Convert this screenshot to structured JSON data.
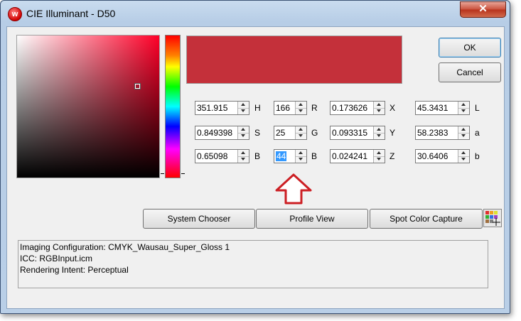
{
  "window": {
    "title": "CIE Illuminant - D50",
    "close_glyph": "✕",
    "app_icon_letter": "w"
  },
  "buttons": {
    "ok": "OK",
    "cancel": "Cancel",
    "system_chooser": "System Chooser",
    "profile_view": "Profile View",
    "spot_color_capture": "Spot Color Capture"
  },
  "preview_color": "#c4303a",
  "fields": {
    "hsb": [
      {
        "value": "351.915",
        "label": "H"
      },
      {
        "value": "0.849398",
        "label": "S"
      },
      {
        "value": "0.65098",
        "label": "B"
      }
    ],
    "rgb": [
      {
        "value": "166",
        "label": "R"
      },
      {
        "value": "25",
        "label": "G"
      },
      {
        "value": "44",
        "label": "B"
      }
    ],
    "xyz": [
      {
        "value": "0.173626",
        "label": "X"
      },
      {
        "value": "0.093315",
        "label": "Y"
      },
      {
        "value": "0.024241",
        "label": "Z"
      }
    ],
    "lab": [
      {
        "value": "45.3431",
        "label": "L"
      },
      {
        "value": "58.2383",
        "label": "a"
      },
      {
        "value": "30.6406",
        "label": "b"
      }
    ]
  },
  "info": {
    "line1": "Imaging Configuration: CMYK_Wausau_Super_Gloss 1",
    "line2": "ICC: RGBInput.icm",
    "line3": "Rendering Intent: Perceptual"
  },
  "icons": {
    "palette": "color-palette-icon",
    "annotation": "red-up-arrow-icon"
  }
}
